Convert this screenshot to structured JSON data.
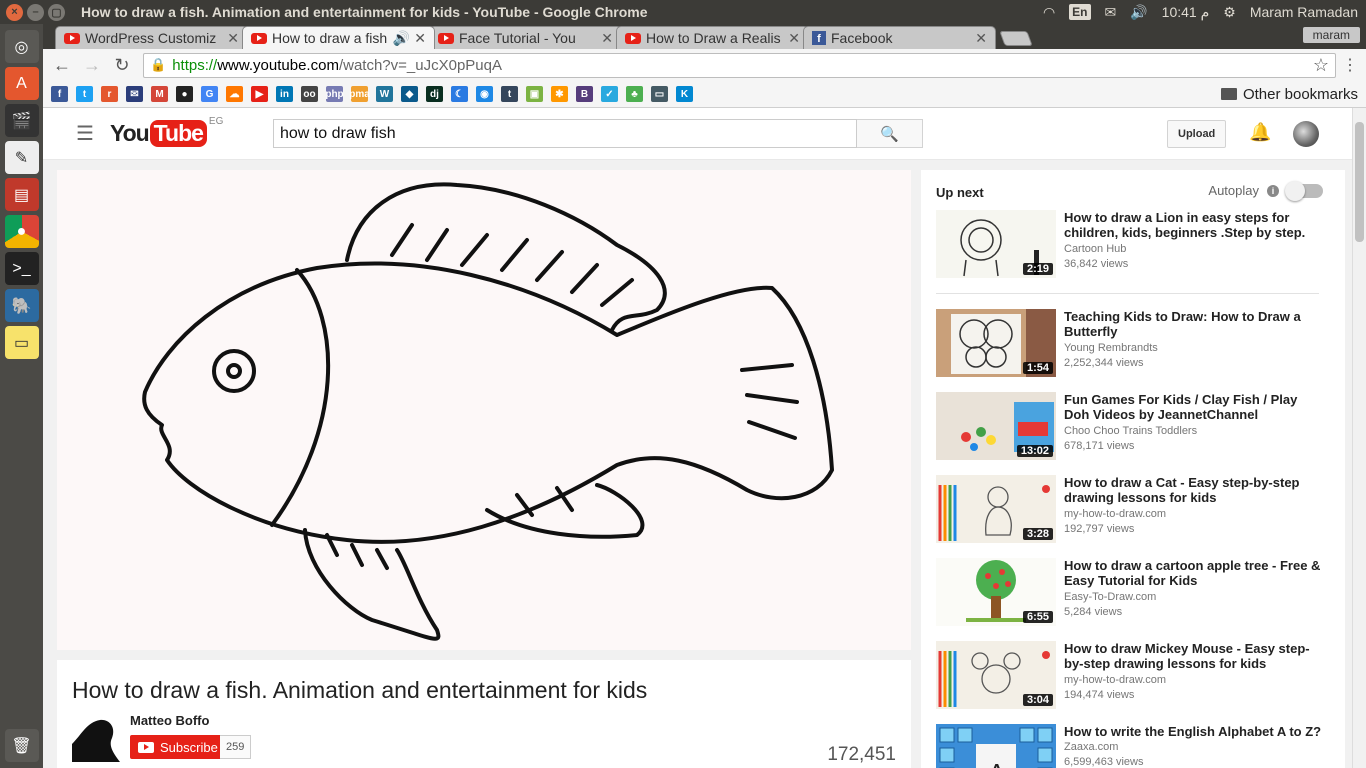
{
  "window": {
    "title": "How to draw a fish. Animation and entertainment for kids - YouTube - Google Chrome"
  },
  "system": {
    "lang": "En",
    "clock": "10:41 م",
    "user": "Maram Ramadan"
  },
  "tabs": [
    {
      "label": "WordPress Customiz",
      "type": "youtube"
    },
    {
      "label": "How to draw a fish",
      "type": "youtube",
      "active": true,
      "audio": true
    },
    {
      "label": "Face Tutorial - You",
      "type": "youtube"
    },
    {
      "label": "How to Draw a Realis",
      "type": "youtube"
    },
    {
      "label": "Facebook",
      "type": "facebook"
    }
  ],
  "profile": "maram",
  "address": {
    "scheme": "https://",
    "host": "www.youtube.com",
    "path": "/watch?v=_uJcX0pPuqA"
  },
  "bookmarks": {
    "other_label": "Other bookmarks"
  },
  "youtube": {
    "logo_you": "You",
    "logo_tube": "Tube",
    "country": "EG",
    "search_value": "how to draw fish",
    "upload_label": "Upload"
  },
  "video": {
    "title": "How to draw a fish. Animation and entertainment for kids",
    "channel": "Matteo Boffo",
    "subscribe_label": "Subscribe",
    "subscribers": "259",
    "views": "172,451"
  },
  "sidebar": {
    "upnext_label": "Up next",
    "autoplay_label": "Autoplay",
    "items": [
      {
        "title": "How to draw a Lion in easy steps for children, kids, beginners .Step by step.",
        "channel": "Cartoon Hub",
        "views": "36,842 views",
        "duration": "2:19"
      },
      {
        "title": "Teaching Kids to Draw: How to Draw a Butterfly",
        "channel": "Young Rembrandts",
        "views": "2,252,344 views",
        "duration": "1:54"
      },
      {
        "title": "Fun Games For Kids / Clay Fish / Play Doh Videos by JeannetChannel",
        "channel": "Choo Choo Trains Toddlers",
        "views": "678,171 views",
        "duration": "13:02"
      },
      {
        "title": "How to draw a Cat - Easy step-by-step drawing lessons for kids",
        "channel": "my-how-to-draw.com",
        "views": "192,797 views",
        "duration": "3:28"
      },
      {
        "title": "How to draw a cartoon apple tree - Free & Easy Tutorial for Kids",
        "channel": "Easy-To-Draw.com",
        "views": "5,284 views",
        "duration": "6:55"
      },
      {
        "title": "How to draw Mickey Mouse - Easy step-by-step drawing lessons for kids",
        "channel": "my-how-to-draw.com",
        "views": "194,474 views",
        "duration": "3:04"
      },
      {
        "title": "How to write the English Alphabet A to Z?",
        "channel": "Zaaxa.com",
        "views": "6,599,463 views",
        "duration": ""
      }
    ]
  },
  "colors": {
    "youtube_red": "#e62117",
    "ubuntu_panel": "#3c3b37",
    "secure_green": "#0a8f08"
  }
}
